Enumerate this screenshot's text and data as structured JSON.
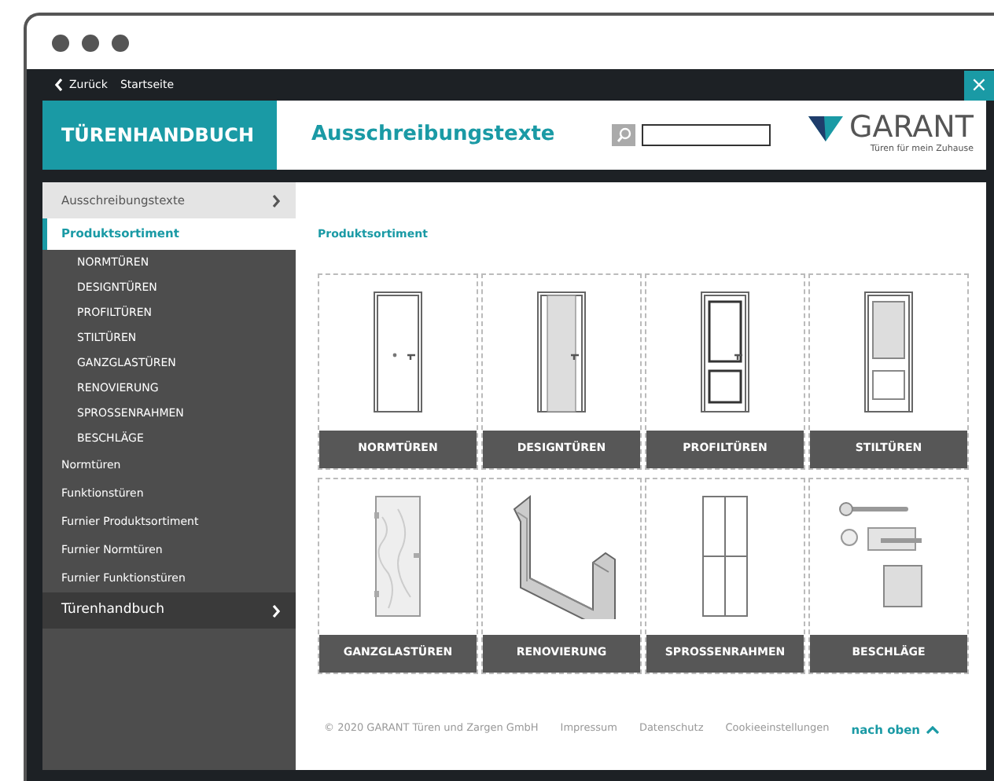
{
  "top_bar": {
    "back": "Zurück",
    "home": "Startseite",
    "close": "×"
  },
  "header": {
    "brand": "TÜRENHANDBUCH",
    "page_title": "Ausschreibungstexte",
    "logo": {
      "name": "GARANT",
      "tagline": "Türen für mein Zuhause"
    }
  },
  "sidebar": {
    "sections": [
      {
        "label": "Ausschreibungstexte",
        "expanded": true,
        "children": [
          {
            "label": "Produktsortiment",
            "selected": true,
            "children": [
              {
                "label": "NORMTÜREN",
                "selected": false
              },
              {
                "label": "DESIGNTÜREN",
                "selected": false
              },
              {
                "label": "PROFILTÜREN",
                "selected": false
              },
              {
                "label": "STILTÜREN",
                "selected": false
              },
              {
                "label": "GANZGLASTÜREN",
                "selected": false
              },
              {
                "label": "RENOVIERUNG",
                "selected": false
              },
              {
                "label": "SPROSSENRAHMEN",
                "selected": false
              },
              {
                "label": "BESCHLÄGE",
                "selected": false
              }
            ]
          },
          {
            "label": "Normtüren",
            "selected": false
          },
          {
            "label": "Funktionstüren",
            "selected": false
          },
          {
            "label": "Furnier Produktsortiment",
            "selected": false
          },
          {
            "label": "Furnier Normtüren",
            "selected": false
          },
          {
            "label": "Furnier Funktionstüren",
            "selected": false
          }
        ]
      },
      {
        "label": "Türenhandbuch",
        "expanded": false
      }
    ]
  },
  "main": {
    "heading": "Produktsortiment",
    "tiles": [
      {
        "label": "NORMTÜREN",
        "kind": "plain"
      },
      {
        "label": "DESIGNTÜREN",
        "kind": "design"
      },
      {
        "label": "PROFILTÜREN",
        "kind": "profile"
      },
      {
        "label": "STILTÜREN",
        "kind": "style"
      },
      {
        "label": "GANZGLASTÜREN",
        "kind": "glass"
      },
      {
        "label": "RENOVIERUNG",
        "kind": "renovation"
      },
      {
        "label": "SPROSSENRAHMEN",
        "kind": "muntin"
      },
      {
        "label": "BESCHLÄGE",
        "kind": "hardware"
      }
    ]
  },
  "footer": {
    "copyright": "© 2020 GARANT Türen und Zargen GmbH",
    "links": [
      "Impressum",
      "Datenschutz",
      "Cookieeinstellungen"
    ],
    "to_top": "nach oben"
  }
}
